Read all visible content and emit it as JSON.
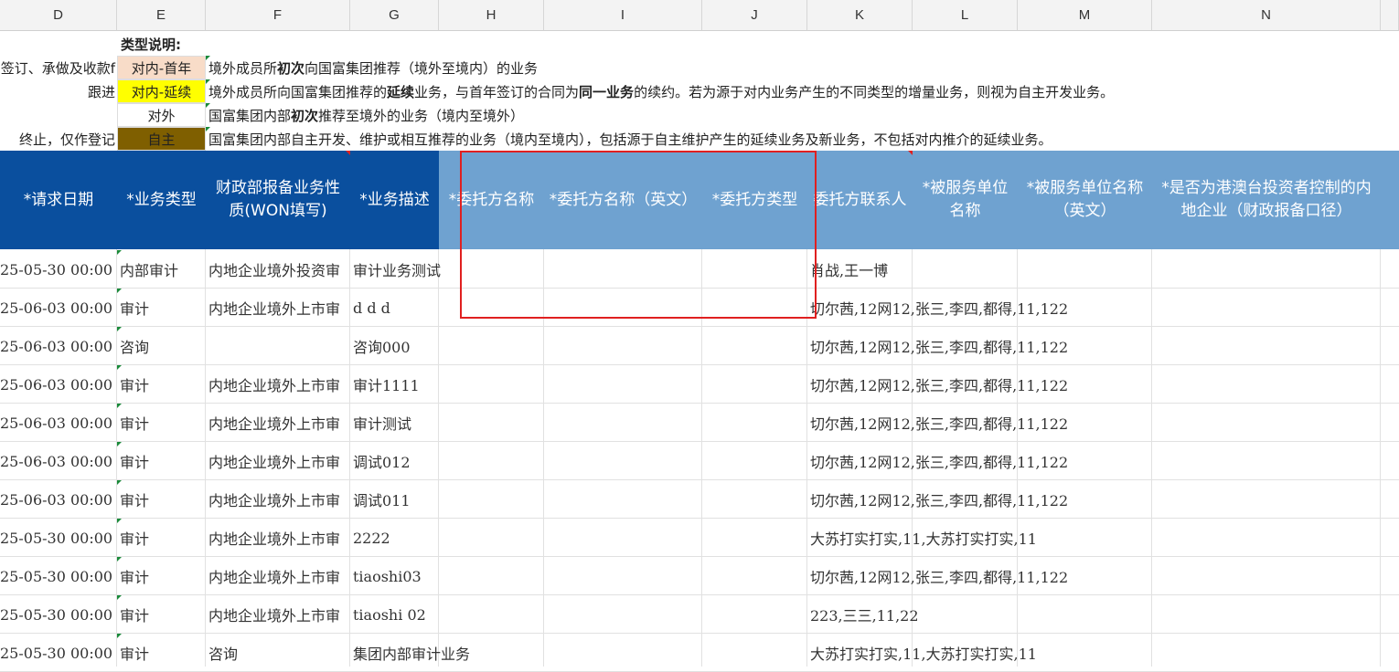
{
  "columns": [
    "D",
    "E",
    "F",
    "G",
    "H",
    "I",
    "J",
    "K",
    "L",
    "M",
    "N"
  ],
  "legend": {
    "title": "类型说明:",
    "rows": [
      {
        "d_text": "签订、承做及收款f",
        "type_label": "对内-首年",
        "type_color": "#f8dcc8",
        "desc_parts": [
          {
            "t": "境外成员所",
            "b": false
          },
          {
            "t": "初次",
            "b": true
          },
          {
            "t": "向国富集团推荐（境外至境内）的业务",
            "b": false
          }
        ]
      },
      {
        "d_text": "跟进",
        "type_label": "对内-延续",
        "type_color": "#ffff00",
        "desc_parts": [
          {
            "t": "境外成员所向国富集团推荐的",
            "b": false
          },
          {
            "t": "延续",
            "b": true
          },
          {
            "t": "业务，与首年签订的合同为",
            "b": false
          },
          {
            "t": "同一业务",
            "b": true
          },
          {
            "t": "的续约。若为源于对内业务产生的不同类型的增量业务，则视为自主开发业务。",
            "b": false
          }
        ]
      },
      {
        "d_text": "",
        "type_label": "对外",
        "type_color": "#ffffff",
        "desc_parts": [
          {
            "t": "国富集团内部",
            "b": false
          },
          {
            "t": "初次",
            "b": true
          },
          {
            "t": "推荐至境外的业务（境内至境外）",
            "b": false
          }
        ]
      },
      {
        "d_text": "终止，仅作登记",
        "type_label": "自主",
        "type_color": "#7f5f00",
        "desc_parts": [
          {
            "t": "国富集团内部自主开发、维护或相互推荐的业务（境内至境内），包括源于自主维护产生的延续业务及新业务，不包括对内推介的延续业务。",
            "b": false
          }
        ]
      }
    ]
  },
  "headers": {
    "request_date": "*请求日期",
    "business_type": "*业务类型",
    "mof_nature": "财政部报备业务性质(WON填写)",
    "business_desc": "*业务描述",
    "client_name": "*委托方名称",
    "client_name_en": "*委托方名称（英文）",
    "client_type": "*委托方类型",
    "client_contact": "委托方联系人",
    "served_unit_name": "*被服务单位名称",
    "served_unit_name_en": "*被服务单位名称（英文）",
    "hk_macao_tw": "*是否为港澳台投资者控制的内地企业（财政报备口径）"
  },
  "rows": [
    {
      "date": "25-05-30 00:00",
      "type": "内部审计",
      "nature": "内地企业境外投资审",
      "desc": "审计业务测试",
      "contact": "肖战,王一博"
    },
    {
      "date": "25-06-03 00:00",
      "type": "审计",
      "nature": "内地企业境外上市审",
      "desc": "d d d",
      "contact": "切尔茜,12网12,张三,李四,都得,11,122"
    },
    {
      "date": "25-06-03 00:00",
      "type": "咨询",
      "nature": "",
      "desc": "咨询000",
      "contact": "切尔茜,12网12,张三,李四,都得,11,122"
    },
    {
      "date": "25-06-03 00:00",
      "type": "审计",
      "nature": "内地企业境外上市审",
      "desc": "审计1111",
      "contact": "切尔茜,12网12,张三,李四,都得,11,122"
    },
    {
      "date": "25-06-03 00:00",
      "type": "审计",
      "nature": "内地企业境外上市审",
      "desc": "审计测试",
      "contact": "切尔茜,12网12,张三,李四,都得,11,122"
    },
    {
      "date": "25-06-03 00:00",
      "type": "审计",
      "nature": "内地企业境外上市审",
      "desc": "调试012",
      "contact": "切尔茜,12网12,张三,李四,都得,11,122"
    },
    {
      "date": "25-06-03 00:00",
      "type": "审计",
      "nature": "内地企业境外上市审",
      "desc": "调试011",
      "contact": "切尔茜,12网12,张三,李四,都得,11,122"
    },
    {
      "date": "25-05-30 00:00",
      "type": "审计",
      "nature": "内地企业境外上市审",
      "desc": "2222",
      "contact": "大苏打实打实,11,大苏打实打实,11"
    },
    {
      "date": "25-05-30 00:00",
      "type": "审计",
      "nature": "内地企业境外上市审",
      "desc": "tiaoshi03",
      "contact": "切尔茜,12网12,张三,李四,都得,11,122"
    },
    {
      "date": "25-05-30 00:00",
      "type": "审计",
      "nature": "内地企业境外上市审",
      "desc": "tiaoshi 02",
      "contact": "223,三三,11,22"
    },
    {
      "date": "25-05-30 00:00",
      "type": "审计",
      "nature": "咨询",
      "desc": "集团内部审计业务",
      "contact": "大苏打实打实,11,大苏打实打实,11"
    }
  ],
  "colors": {
    "header_dark_blue": "#0a4f9e",
    "header_light_blue": "#6fa2d0",
    "highlight_box": "#e02020"
  }
}
